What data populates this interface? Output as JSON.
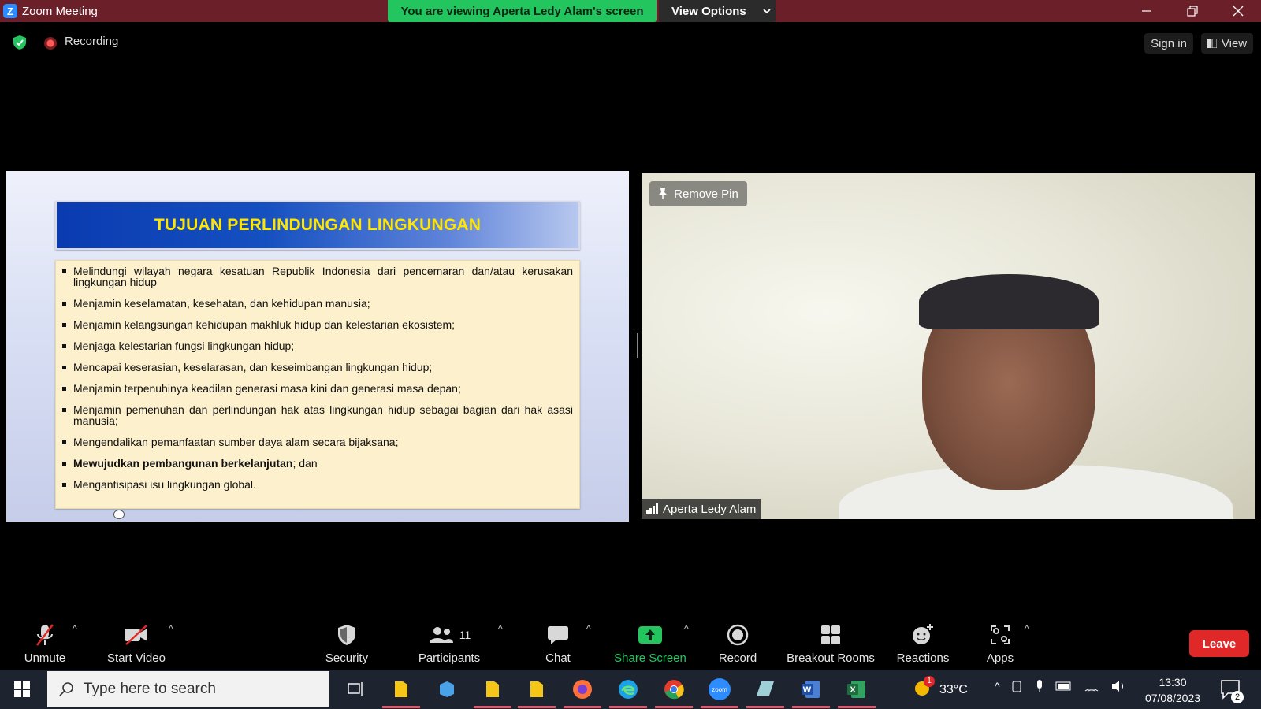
{
  "window": {
    "app_title": "Zoom Meeting",
    "viewing_banner": "You are viewing Aperta Ledy Alam's screen",
    "view_options": "View Options"
  },
  "status": {
    "recording_label": "Recording",
    "sign_in": "Sign in",
    "view": "View"
  },
  "slide": {
    "title": "TUJUAN PERLINDUNGAN LINGKUNGAN",
    "bullets": [
      "Melindungi wilayah negara kesatuan Republik Indonesia dari pencemaran dan/atau kerusakan lingkungan hidup",
      "Menjamin keselamatan, kesehatan, dan kehidupan manusia;",
      "Menjamin kelangsungan kehidupan makhluk hidup dan kelestarian ekosistem;",
      "Menjaga kelestarian fungsi lingkungan hidup;",
      "Mencapai keserasian, keselarasan, dan keseimbangan lingkungan hidup;",
      "Menjamin terpenuhinya keadilan generasi masa kini dan generasi masa depan;",
      "Menjamin pemenuhan dan perlindungan hak atas lingkungan hidup sebagai bagian dari hak asasi manusia;",
      "Mengendalikan pemanfaatan sumber daya alam secara bijaksana;",
      "Mengantisipasi isu lingkungan global."
    ],
    "bullet_bold_part": "Mewujudkan pembangunan berkelanjutan",
    "bullet_bold_rest": "; dan"
  },
  "video": {
    "remove_pin": "Remove Pin",
    "participant_name": "Aperta Ledy Alam"
  },
  "toolbar": {
    "unmute": "Unmute",
    "start_video": "Start Video",
    "security": "Security",
    "participants": "Participants",
    "participant_count": "11",
    "chat": "Chat",
    "share_screen": "Share Screen",
    "record": "Record",
    "breakout_rooms": "Breakout Rooms",
    "reactions": "Reactions",
    "apps": "Apps",
    "leave": "Leave"
  },
  "taskbar": {
    "search_placeholder": "Type here to search",
    "temperature": "33°C",
    "weather_badge": "1",
    "time": "13:30",
    "date": "07/08/2023",
    "notification_count": "2"
  },
  "colors": {
    "titlebar": "#6b1f28",
    "banner": "#23c55e",
    "leave": "#e02828",
    "share_green": "#23c55e",
    "slide_title": "#ffe600"
  }
}
